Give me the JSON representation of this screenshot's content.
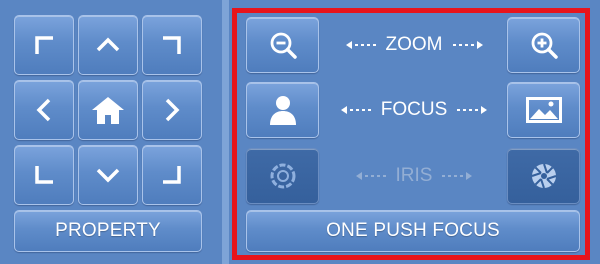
{
  "ptz": {
    "property_label": "PROPERTY",
    "directions": [
      "up-left",
      "up",
      "up-right",
      "left",
      "home",
      "right",
      "down-left",
      "down",
      "down-right"
    ]
  },
  "lens": {
    "zoom_label": "ZOOM",
    "focus_label": "FOCUS",
    "iris_label": "IRIS",
    "one_push_focus_label": "ONE PUSH FOCUS"
  },
  "colors": {
    "panel": "#5a86c3",
    "highlight_border": "#e8141b",
    "disabled_text": "#93aed4"
  }
}
